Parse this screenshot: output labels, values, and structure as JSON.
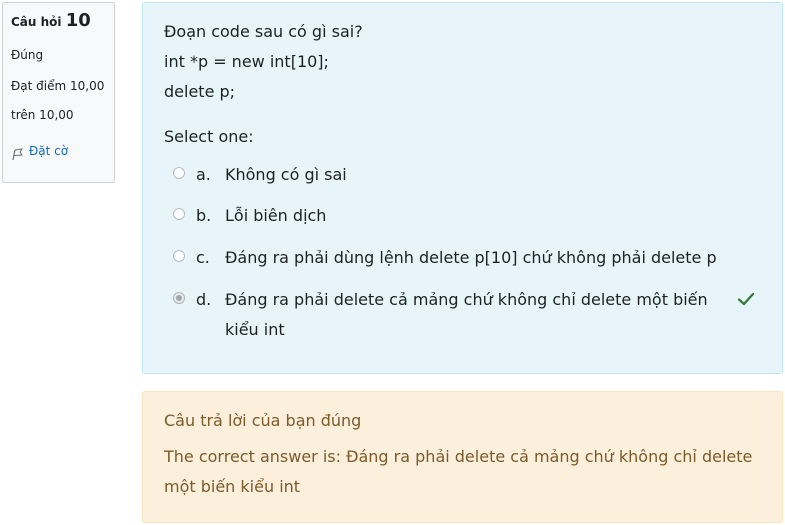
{
  "info": {
    "question_label": "Câu hỏi",
    "question_number": "10",
    "state": "Đúng",
    "grade_line1": "Đạt điểm 10,00",
    "grade_line2": "trên 10,00",
    "flag_label": "Đặt cờ",
    "flag_icon": "flag-icon"
  },
  "question": {
    "line1": "Đoạn code sau có gì sai?",
    "line2": "int *p = new int[10];",
    "line3": "delete p;",
    "prompt": "Select one:"
  },
  "answers": [
    {
      "letter": "a.",
      "text": "Không có gì sai",
      "selected": false
    },
    {
      "letter": "b.",
      "text": "Lỗi biên dịch",
      "selected": false
    },
    {
      "letter": "c.",
      "text": "Đáng ra phải dùng lệnh delete p[10] chứ không phải delete p",
      "selected": false
    },
    {
      "letter": "d.",
      "text": "Đáng ra phải delete cả mảng chứ không chỉ delete một biến kiểu int",
      "selected": true,
      "correct_icon": "check-icon"
    }
  ],
  "feedback": {
    "result": "Câu trả lời của bạn đúng",
    "correct_answer": "The correct answer is: Đáng ra phải delete cả mảng chứ không chỉ delete một biến kiểu int"
  },
  "colors": {
    "info_bg": "#f8f9fa",
    "question_bg": "#e7f5fb",
    "feedback_bg": "#fcefdc",
    "feedback_text": "#7d5a29",
    "link": "#0f6cbf",
    "check": "#357a32"
  }
}
